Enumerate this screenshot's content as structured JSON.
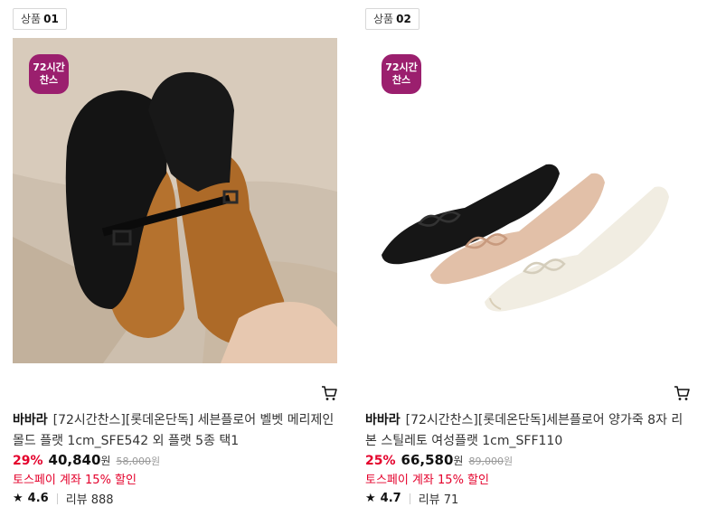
{
  "products": [
    {
      "tag_label": "상품",
      "tag_num": "01",
      "badge_line1": "72시간",
      "badge_line2": "찬스",
      "brand": "바바라",
      "name": "[72시간찬스][롯데온단독] 세븐플로어 벨벳 메리제인 몰드 플랫 1cm_SFE542 외 플랫 5종 택1",
      "discount": "29%",
      "price": "40,840",
      "currency": "원",
      "original_price": "58,000",
      "original_currency": "원",
      "promo": "토스페이 계좌 15% 할인",
      "rating": "4.6",
      "reviews": "리뷰 888",
      "cart_icon": "cart-icon"
    },
    {
      "tag_label": "상품",
      "tag_num": "02",
      "badge_line1": "72시간",
      "badge_line2": "찬스",
      "brand": "바바라",
      "name": "[72시간찬스][롯데온단독]세븐플로어 양가죽 8자 리본 스틸레토 여성플랫 1cm_SFF110",
      "discount": "25%",
      "price": "66,580",
      "currency": "원",
      "original_price": "89,000",
      "original_currency": "원",
      "promo": "토스페이 계좌 15% 할인",
      "rating": "4.7",
      "reviews": "리뷰 71",
      "cart_icon": "cart-icon"
    }
  ],
  "colors": {
    "accent_red": "#e4002b",
    "badge_purple": "#9b1f6e"
  }
}
